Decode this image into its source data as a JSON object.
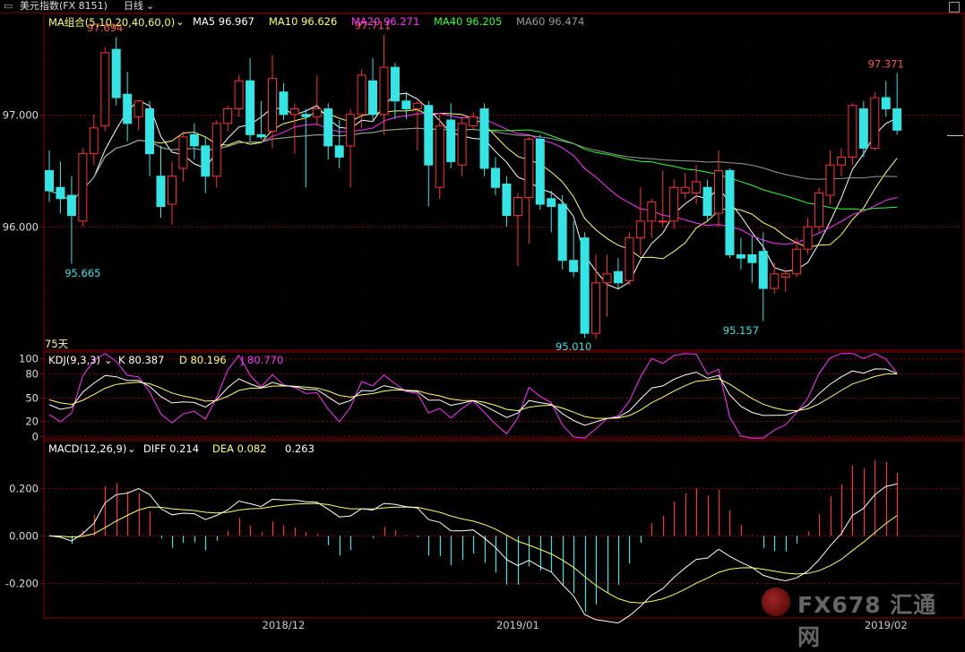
{
  "header": {
    "title": "美元指数(FX 8151)",
    "period": "日线",
    "title_icon": "window-icon",
    "close_icon": "close-icon"
  },
  "main_panel": {
    "indicator": "MA组合(5,10,20,40,60,0)",
    "ma_labels": [
      {
        "text": "MA5 96.967",
        "color": "#ffffff"
      },
      {
        "text": "MA10 96.626",
        "color": "#ffff66"
      },
      {
        "text": "MA20 96.271",
        "color": "#ff33ff"
      },
      {
        "text": "MA40 96.205",
        "color": "#33ff33"
      },
      {
        "text": "MA60 96.474",
        "color": "#999999"
      }
    ],
    "period_label": "75天"
  },
  "kdj_panel": {
    "indicator": "KDJ(9,3,3)",
    "labels": [
      {
        "text": "K 80.387",
        "color": "#ffffff"
      },
      {
        "text": "D 80.196",
        "color": "#ffff66"
      },
      {
        "text": "J 80.770",
        "color": "#ff33ff"
      }
    ]
  },
  "macd_panel": {
    "indicator": "MACD(12,26,9)",
    "labels": [
      {
        "text": "DIFF 0.214",
        "color": "#ffffff"
      },
      {
        "text": "DEA 0.082",
        "color": "#ffff66"
      },
      {
        "text": "0.263",
        "color": "#ffffff"
      }
    ]
  },
  "watermark": {
    "text": "FX678 汇通网"
  },
  "chart_data": {
    "type": "candlestick",
    "up_color": "#ff3333",
    "down_color": "#33e5e5",
    "price_axis": {
      "ticks": [
        96.0,
        97.0
      ],
      "tick_labels": [
        "96.000",
        "97.000"
      ],
      "ylim": [
        94.9,
        97.9
      ]
    },
    "kdj_axis": {
      "ticks": [
        0,
        20,
        50,
        80,
        100
      ],
      "tick_labels": [
        "0",
        "20",
        "50",
        "80",
        "100"
      ],
      "ylim": [
        -3,
        108
      ]
    },
    "macd_axis": {
      "ticks": [
        -0.2,
        0,
        0.2
      ],
      "tick_labels": [
        "-0.200",
        "0.000",
        "0.200"
      ],
      "ylim": [
        -0.345,
        0.4
      ]
    },
    "x_labels": [
      {
        "index": 21,
        "label": "2018/12"
      },
      {
        "index": 42,
        "label": "2019/01"
      },
      {
        "index": 75,
        "label": "2019/02"
      }
    ],
    "annotations": [
      {
        "index": 3,
        "value": 95.665,
        "text": "95.665",
        "color": "#33e5e5",
        "pos": "below"
      },
      {
        "index": 5,
        "value": 97.694,
        "text": "97.694",
        "color": "#ff5555",
        "pos": "above"
      },
      {
        "index": 29,
        "value": 97.711,
        "text": "97.711",
        "color": "#ff5555",
        "pos": "above"
      },
      {
        "index": 47,
        "value": 95.01,
        "text": "95.010",
        "color": "#33e5e5",
        "pos": "below"
      },
      {
        "index": 62,
        "value": 95.157,
        "text": "95.157",
        "color": "#33e5e5",
        "pos": "below"
      },
      {
        "index": 75,
        "value": 97.371,
        "text": "97.371",
        "color": "#ff5555",
        "pos": "above"
      }
    ],
    "candles": [
      {
        "o": 96.5,
        "h": 96.68,
        "c": 96.32,
        "l": 96.22
      },
      {
        "o": 96.35,
        "h": 96.58,
        "c": 96.25,
        "l": 96.12
      },
      {
        "o": 96.28,
        "h": 96.45,
        "c": 96.1,
        "l": 95.67
      },
      {
        "o": 96.05,
        "h": 96.7,
        "c": 96.65,
        "l": 96.0
      },
      {
        "o": 96.65,
        "h": 97.0,
        "c": 96.88,
        "l": 96.55
      },
      {
        "o": 96.9,
        "h": 97.6,
        "c": 97.55,
        "l": 96.85
      },
      {
        "o": 97.58,
        "h": 97.69,
        "c": 97.15,
        "l": 97.08
      },
      {
        "o": 97.18,
        "h": 97.38,
        "c": 96.92,
        "l": 96.76
      },
      {
        "o": 96.98,
        "h": 97.12,
        "c": 97.12,
        "l": 96.86
      },
      {
        "o": 97.05,
        "h": 97.12,
        "c": 96.65,
        "l": 96.45
      },
      {
        "o": 96.45,
        "h": 96.72,
        "c": 96.18,
        "l": 96.08
      },
      {
        "o": 96.2,
        "h": 96.58,
        "c": 96.45,
        "l": 96.02
      },
      {
        "o": 96.52,
        "h": 96.85,
        "c": 96.8,
        "l": 96.4
      },
      {
        "o": 96.82,
        "h": 96.92,
        "c": 96.72,
        "l": 96.6
      },
      {
        "o": 96.72,
        "h": 96.8,
        "c": 96.45,
        "l": 96.3
      },
      {
        "o": 96.45,
        "h": 96.95,
        "c": 96.92,
        "l": 96.35
      },
      {
        "o": 96.92,
        "h": 97.08,
        "c": 97.05,
        "l": 96.85
      },
      {
        "o": 97.05,
        "h": 97.35,
        "c": 97.3,
        "l": 96.98
      },
      {
        "o": 97.3,
        "h": 97.5,
        "c": 96.82,
        "l": 96.76
      },
      {
        "o": 96.82,
        "h": 97.12,
        "c": 96.8,
        "l": 96.78
      },
      {
        "o": 96.85,
        "h": 97.53,
        "c": 97.32,
        "l": 96.7
      },
      {
        "o": 97.2,
        "h": 97.28,
        "c": 97.0,
        "l": 96.95
      },
      {
        "o": 97.0,
        "h": 97.1,
        "c": 97.05,
        "l": 96.65
      },
      {
        "o": 97.0,
        "h": 97.05,
        "c": 96.98,
        "l": 96.35
      },
      {
        "o": 96.98,
        "h": 97.35,
        "c": 97.05,
        "l": 96.9
      },
      {
        "o": 97.05,
        "h": 97.1,
        "c": 96.72,
        "l": 96.6
      },
      {
        "o": 96.72,
        "h": 96.95,
        "c": 96.62,
        "l": 96.52
      },
      {
        "o": 96.72,
        "h": 97.05,
        "c": 97.0,
        "l": 96.35
      },
      {
        "o": 97.0,
        "h": 97.4,
        "c": 97.35,
        "l": 96.88
      },
      {
        "o": 97.3,
        "h": 97.5,
        "c": 97.0,
        "l": 96.95
      },
      {
        "o": 97.0,
        "h": 97.71,
        "c": 97.42,
        "l": 96.82
      },
      {
        "o": 97.42,
        "h": 97.46,
        "c": 97.12,
        "l": 96.96
      },
      {
        "o": 97.12,
        "h": 97.2,
        "c": 97.05,
        "l": 96.96
      },
      {
        "o": 97.05,
        "h": 97.12,
        "c": 97.1,
        "l": 96.68
      },
      {
        "o": 97.08,
        "h": 97.12,
        "c": 96.55,
        "l": 96.18
      },
      {
        "o": 96.35,
        "h": 97.0,
        "c": 96.9,
        "l": 96.25
      },
      {
        "o": 96.95,
        "h": 97.1,
        "c": 96.58,
        "l": 96.52
      },
      {
        "o": 96.55,
        "h": 96.98,
        "c": 96.92,
        "l": 96.45
      },
      {
        "o": 96.9,
        "h": 97.02,
        "c": 96.98,
        "l": 96.86
      },
      {
        "o": 97.05,
        "h": 97.1,
        "c": 96.52,
        "l": 96.45
      },
      {
        "o": 96.52,
        "h": 96.62,
        "c": 96.35,
        "l": 96.28
      },
      {
        "o": 96.38,
        "h": 96.45,
        "c": 96.1,
        "l": 96.0
      },
      {
        "o": 96.1,
        "h": 96.3,
        "c": 96.26,
        "l": 95.65
      },
      {
        "o": 96.26,
        "h": 96.8,
        "c": 96.78,
        "l": 95.85
      },
      {
        "o": 96.78,
        "h": 96.82,
        "c": 96.2,
        "l": 96.15
      },
      {
        "o": 96.25,
        "h": 96.32,
        "c": 96.18,
        "l": 95.95
      },
      {
        "o": 96.2,
        "h": 96.28,
        "c": 95.7,
        "l": 95.62
      },
      {
        "o": 95.7,
        "h": 96.05,
        "c": 95.6,
        "l": 95.55
      },
      {
        "o": 95.9,
        "h": 95.95,
        "c": 95.05,
        "l": 95.01
      },
      {
        "o": 95.05,
        "h": 95.75,
        "c": 95.5,
        "l": 95.0
      },
      {
        "o": 95.5,
        "h": 95.75,
        "c": 95.58,
        "l": 95.2
      },
      {
        "o": 95.6,
        "h": 95.72,
        "c": 95.5,
        "l": 95.45
      },
      {
        "o": 95.52,
        "h": 95.95,
        "c": 95.9,
        "l": 95.48
      },
      {
        "o": 95.9,
        "h": 96.35,
        "c": 96.05,
        "l": 95.75
      },
      {
        "o": 96.05,
        "h": 96.25,
        "c": 96.22,
        "l": 95.9
      },
      {
        "o": 96.05,
        "h": 96.5,
        "c": 96.05,
        "l": 96.0
      },
      {
        "o": 96.05,
        "h": 96.42,
        "c": 96.35,
        "l": 95.98
      },
      {
        "o": 96.3,
        "h": 96.48,
        "c": 96.35,
        "l": 96.25
      },
      {
        "o": 96.3,
        "h": 96.55,
        "c": 96.4,
        "l": 96.2
      },
      {
        "o": 96.35,
        "h": 96.42,
        "c": 96.1,
        "l": 96.05
      },
      {
        "o": 96.12,
        "h": 96.68,
        "c": 96.5,
        "l": 96.0
      },
      {
        "o": 96.5,
        "h": 96.52,
        "c": 95.75,
        "l": 95.72
      },
      {
        "o": 95.75,
        "h": 95.9,
        "c": 95.72,
        "l": 95.62
      },
      {
        "o": 95.75,
        "h": 95.92,
        "c": 95.68,
        "l": 95.5
      },
      {
        "o": 95.78,
        "h": 95.95,
        "c": 95.45,
        "l": 95.16
      },
      {
        "o": 95.45,
        "h": 95.68,
        "c": 95.58,
        "l": 95.4
      },
      {
        "o": 95.55,
        "h": 95.62,
        "c": 95.58,
        "l": 95.42
      },
      {
        "o": 95.58,
        "h": 95.9,
        "c": 95.8,
        "l": 95.55
      },
      {
        "o": 95.8,
        "h": 96.08,
        "c": 96.0,
        "l": 95.75
      },
      {
        "o": 96.0,
        "h": 96.35,
        "c": 96.3,
        "l": 95.95
      },
      {
        "o": 96.28,
        "h": 96.68,
        "c": 96.55,
        "l": 96.2
      },
      {
        "o": 96.55,
        "h": 96.7,
        "c": 96.62,
        "l": 96.45
      },
      {
        "o": 96.62,
        "h": 97.1,
        "c": 97.08,
        "l": 96.55
      },
      {
        "o": 97.05,
        "h": 97.12,
        "c": 96.7,
        "l": 96.62
      },
      {
        "o": 96.7,
        "h": 97.2,
        "c": 97.15,
        "l": 96.68
      },
      {
        "o": 97.15,
        "h": 97.3,
        "c": 97.05,
        "l": 96.98
      },
      {
        "o": 97.05,
        "h": 97.37,
        "c": 96.86,
        "l": 96.82
      }
    ]
  }
}
